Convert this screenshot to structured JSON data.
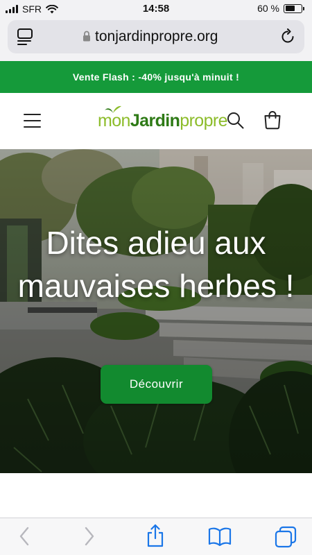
{
  "status_bar": {
    "carrier": "SFR",
    "time": "14:58",
    "battery_percent": "60 %",
    "battery_level": 0.6
  },
  "browser": {
    "url": "tonjardinpropre.org"
  },
  "promo": {
    "text": "Vente Flash : -40% jusqu'à minuit !",
    "color": "#159a3a"
  },
  "header": {
    "logo": {
      "part1": "mon",
      "part2": "Jardin",
      "part3": "propre"
    },
    "icons": [
      "menu-icon",
      "search-icon",
      "cart-icon"
    ]
  },
  "hero": {
    "title": "Dites adieu aux mauvaises herbes !",
    "button_label": "Découvrir",
    "button_color": "#128a2f"
  },
  "toolbar": {
    "icons": [
      "back-icon",
      "forward-icon",
      "share-icon",
      "bookmarks-icon",
      "tabs-icon"
    ]
  }
}
